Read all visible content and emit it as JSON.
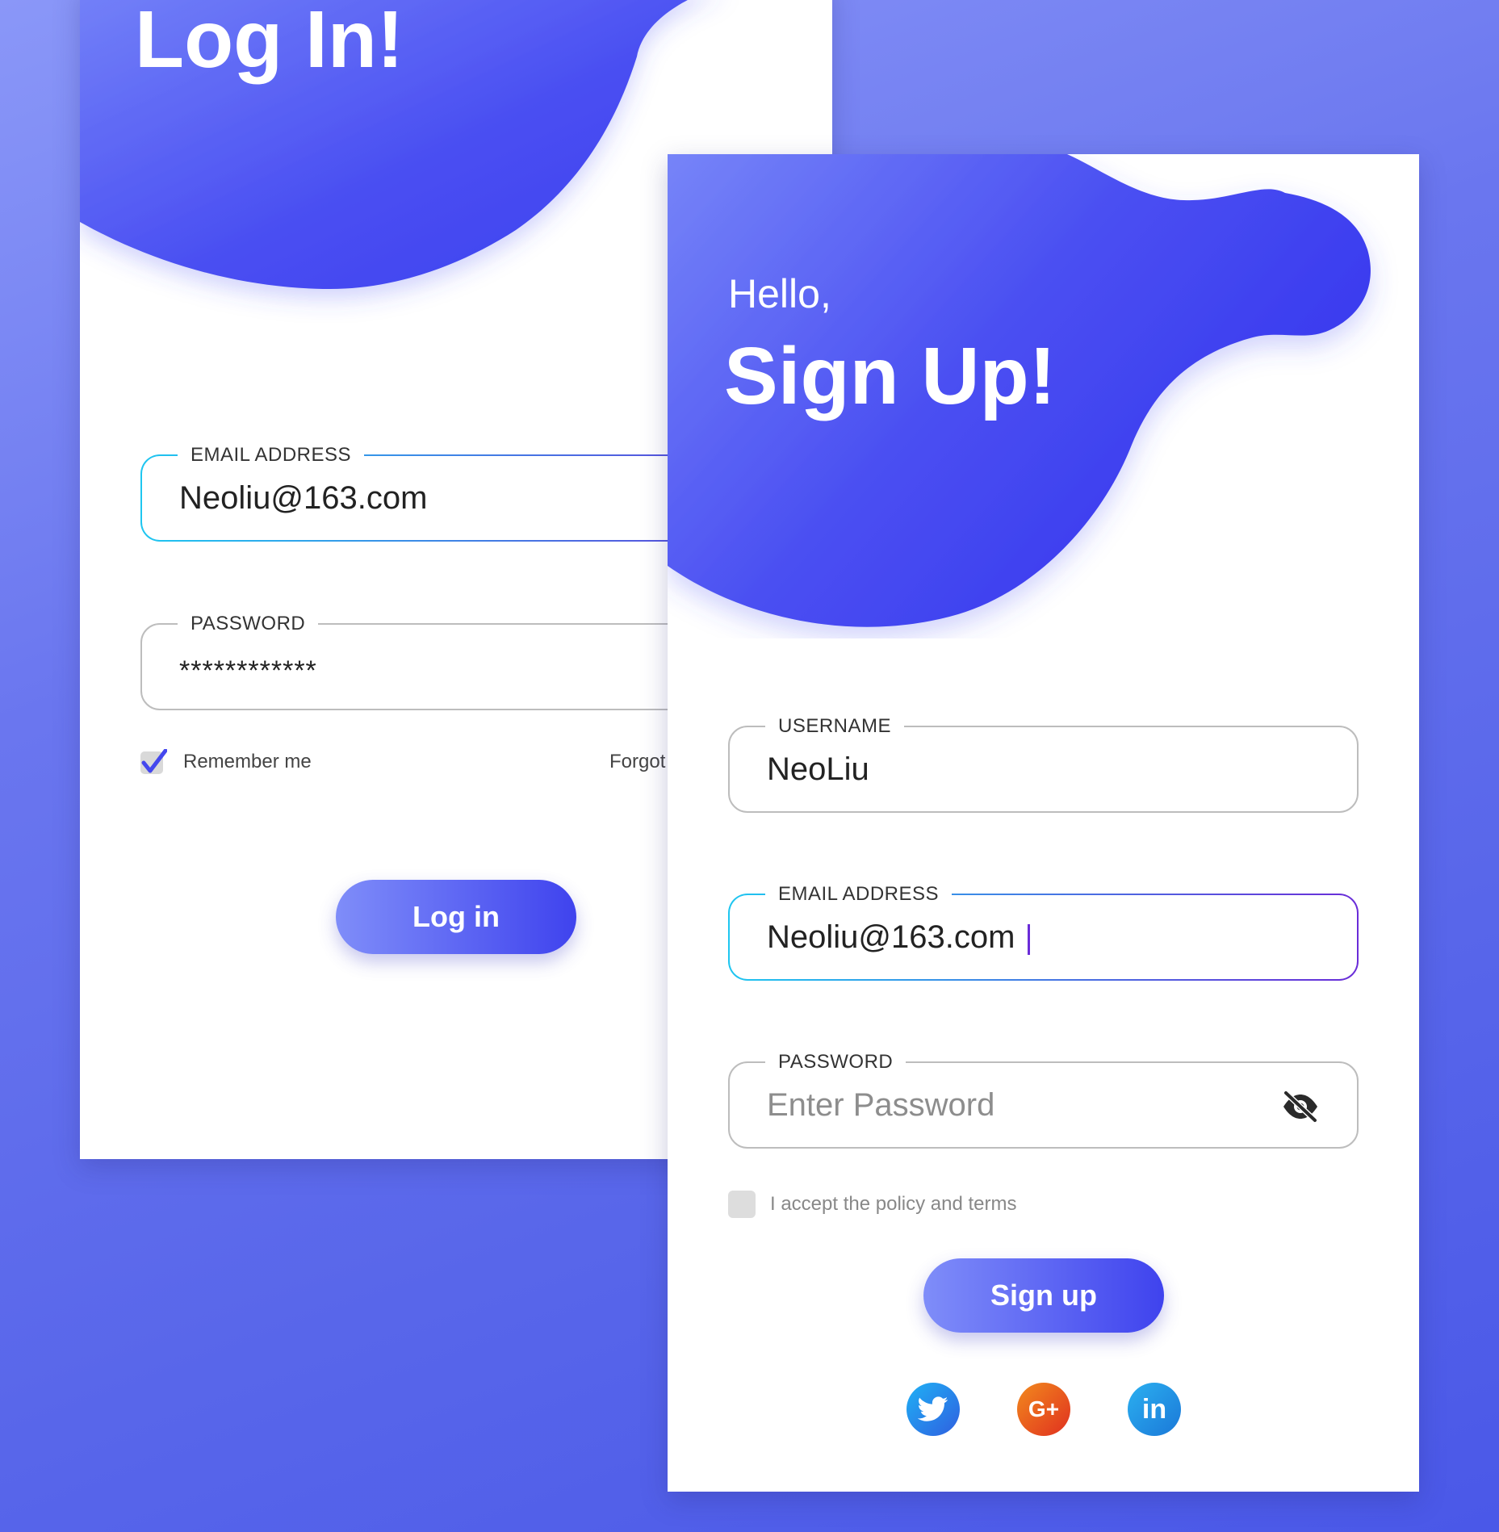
{
  "colors": {
    "accent": "#3d42f0",
    "accent_light": "#7f8df9",
    "field_active_start": "#1ec6f0",
    "field_active_end": "#6a2cd8",
    "twitter": "#1a9af0",
    "google_plus": "#e8401f",
    "linkedin": "#1a8ee0"
  },
  "login": {
    "title": "Log In!",
    "email": {
      "label": "EMAIL ADDRESS",
      "value": "Neoliu@163.com"
    },
    "password": {
      "label": "PASSWORD",
      "value": "************"
    },
    "remember_label": "Remember me",
    "remember_checked": true,
    "forgot_label": "Forgot",
    "button_label": "Log in"
  },
  "signup": {
    "greeting": "Hello,",
    "title": "Sign Up!",
    "username": {
      "label": "USERNAME",
      "value": "NeoLiu"
    },
    "email": {
      "label": "EMAIL ADDRESS",
      "value": "Neoliu@163.com"
    },
    "password": {
      "label": "PASSWORD",
      "placeholder": "Enter Password",
      "toggle_icon": "eye-off-icon"
    },
    "terms_label": "I accept the policy and terms",
    "terms_checked": false,
    "button_label": "Sign up",
    "social": [
      {
        "name": "twitter",
        "icon": "twitter-icon"
      },
      {
        "name": "google-plus",
        "icon": "google-plus-icon",
        "text": "G+"
      },
      {
        "name": "linkedin",
        "icon": "linkedin-icon",
        "text": "in"
      }
    ]
  }
}
